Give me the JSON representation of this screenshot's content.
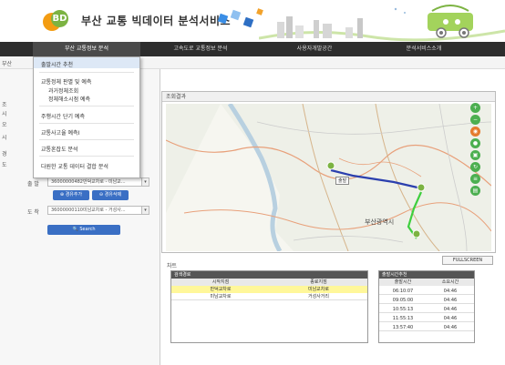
{
  "header": {
    "logo_text": "BD",
    "title": "부산 교통 빅데이터 분석서비스"
  },
  "nav": [
    {
      "label": "부산 교통정보 분석",
      "active": true
    },
    {
      "label": "고속도로 교통정보 분석",
      "active": false
    },
    {
      "label": "사용자개발공간",
      "active": false
    },
    {
      "label": "분석서비스소개",
      "active": false
    }
  ],
  "breadcrumb": "부산",
  "dropdown": {
    "items": [
      {
        "label": "출발시간 추천",
        "sub": false
      },
      {
        "label": "교통정체 판별 및 예측",
        "sub": false
      },
      {
        "label": "과거정체조회",
        "sub": true
      },
      {
        "label": "정체해소시점 예측",
        "sub": true
      },
      {
        "label": "주행시간 단기 예측",
        "sub": false
      },
      {
        "label": "교통사고율 예측Ⅰ",
        "sub": false
      },
      {
        "label": "교통혼잡도 분석",
        "sub": false
      },
      {
        "label": "다원한 교통 데이터 결합 분석",
        "sub": false
      }
    ]
  },
  "left_panel": {
    "labels": [
      "조",
      "시",
      "오",
      "시",
      "경",
      "도"
    ],
    "origin_label": "출 발",
    "origin_value": "36000000482만덕교차로 - 미남교...",
    "dest_label": "도 착",
    "dest_value": "36000000110미남교차로 - 거성사...",
    "add_button": "경유추가",
    "delete_button": "경유삭제",
    "search_button": "Search"
  },
  "map_panel": {
    "title": "조회결과",
    "city_label": "부산광역시",
    "marker_label": "출발"
  },
  "fullscreen_label": "FULLSCREEN",
  "info_label": "차트",
  "route_table": {
    "title": "검색경로",
    "columns": [
      "시작지점",
      "종료지점"
    ],
    "rows": [
      [
        "만덕교차로",
        "미남교차로"
      ],
      [
        "미남교차로",
        "거성사거리"
      ]
    ]
  },
  "time_table": {
    "title": "출발시간추천",
    "columns": [
      "출발시간",
      "소요시간"
    ],
    "rows": [
      [
        "06:10:07",
        "04:46"
      ],
      [
        "09:05:00",
        "04:46"
      ],
      [
        "10:55:13",
        "04:46"
      ],
      [
        "11:55:13",
        "04:46"
      ],
      [
        "13:57:40",
        "04:46"
      ]
    ]
  },
  "colors": {
    "nav_bg": "#2d2d2d",
    "route_blue": "#2b3fae",
    "route_green": "#3fcf3f",
    "highlight_row": "#fff79a",
    "button_blue": "#3a6fc4"
  }
}
